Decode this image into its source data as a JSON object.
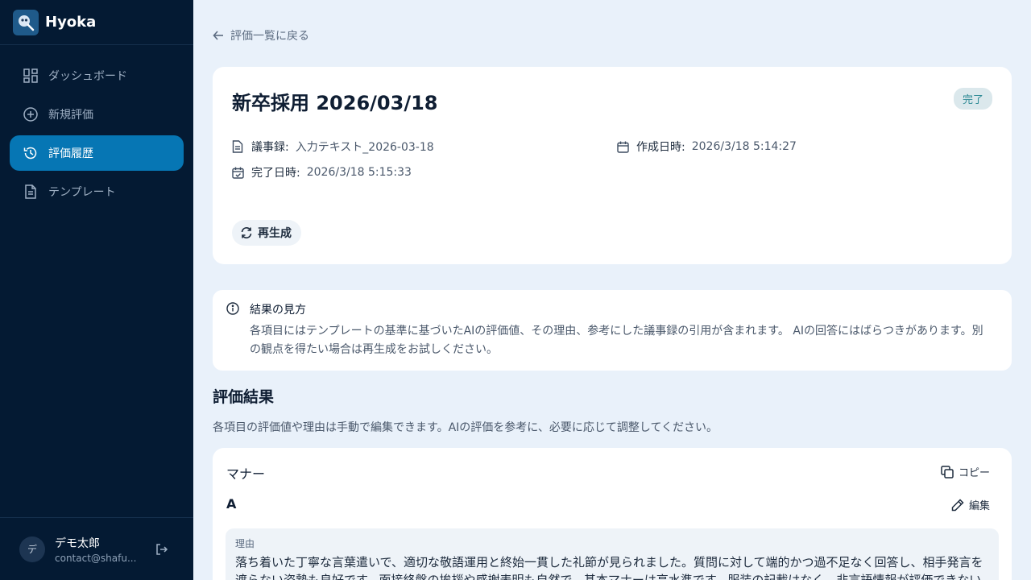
{
  "app": {
    "name": "Hyoka"
  },
  "sidebar": {
    "items": [
      {
        "label": "ダッシュボード",
        "icon": "dashboard-icon",
        "active": false
      },
      {
        "label": "新規評価",
        "icon": "plus-circle-icon",
        "active": false
      },
      {
        "label": "評価履歴",
        "icon": "history-icon",
        "active": true
      },
      {
        "label": "テンプレート",
        "icon": "document-icon",
        "active": false
      }
    ],
    "user": {
      "avatar": "デ",
      "name": "デモ太郎",
      "email": "contact@shafu..."
    }
  },
  "main": {
    "back_label": "評価一覧に戻る",
    "evaluation": {
      "title": "新卒採用 2026/03/18",
      "status": "完了",
      "minutes_label": "議事録:",
      "minutes_value": "入力テキスト_2026-03-18",
      "created_label": "作成日時:",
      "created_value": "2026/3/18 5:14:27",
      "completed_label": "完了日時:",
      "completed_value": "2026/3/18 5:15:33",
      "regenerate_label": "再生成"
    },
    "info": {
      "title": "結果の見方",
      "body": "各項目にはテンプレートの基準に基づいたAIの評価値、その理由、参考にした議事録の引用が含まれます。 AIの回答にはばらつきがあります。別の観点を得たい場合は再生成をお試しください。"
    },
    "results": {
      "title": "評価結果",
      "description": "各項目の評価値や理由は手動で編集できます。AIの評価を参考に、必要に応じて調整してください。",
      "items": [
        {
          "criterion": "マナー",
          "copy_label": "コピー",
          "grade": "A",
          "edit_label": "編集",
          "reason_label": "理由",
          "reason": "落ち着いた丁寧な言葉遣いで、適切な敬語運用と終始一貫した礼節が見られました。質問に対して端的かつ過不足なく回答し、相手発言を遮らない姿勢も良好です。面接終盤の挨拶や感謝表明も自然で、基本マナーは高水準です。服装の記載はなく、非言語情報が評価できないため上限"
        }
      ]
    }
  },
  "colors": {
    "sidebar_bg": "#041a33",
    "active_nav": "#0676b4",
    "page_bg": "#e9f1fa",
    "badge_bg": "#dbe8ec",
    "badge_text": "#2e8a95"
  }
}
